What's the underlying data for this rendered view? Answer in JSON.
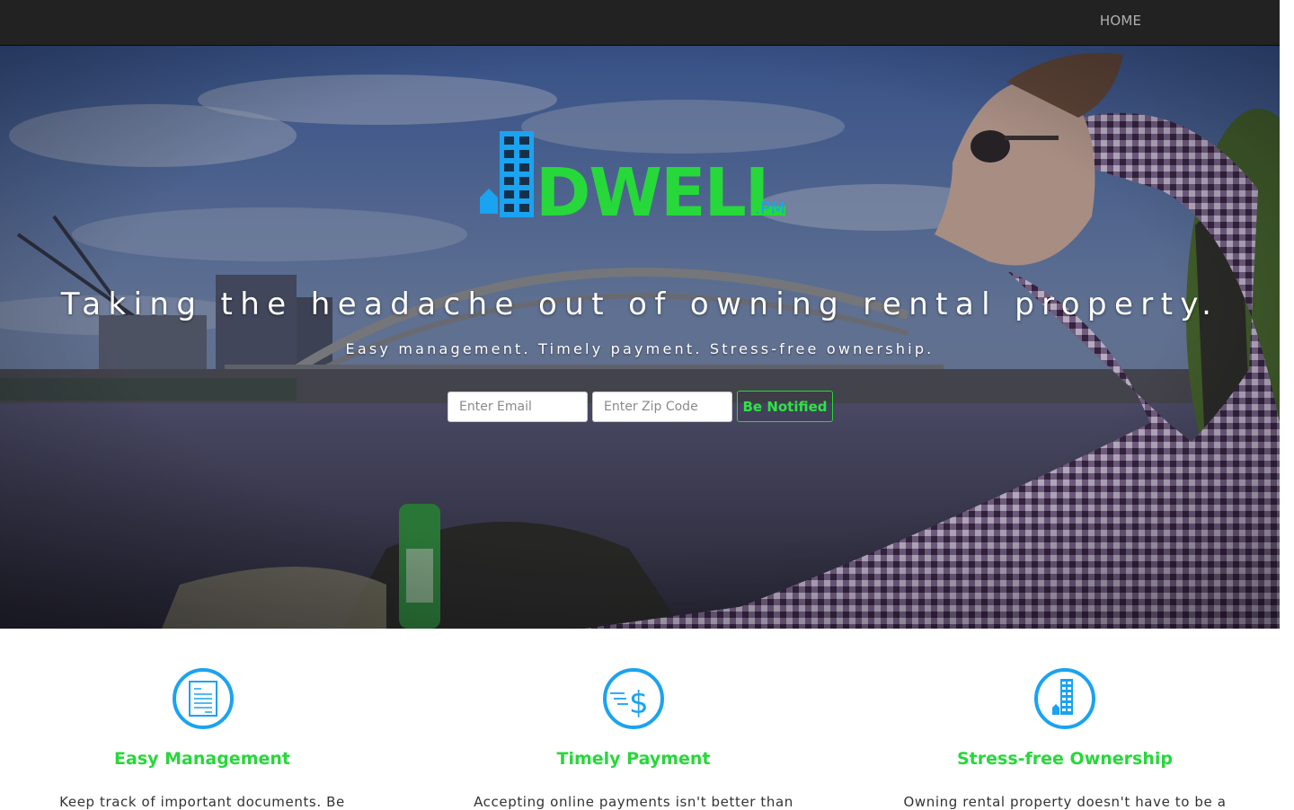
{
  "nav": {
    "home_label": "HOME"
  },
  "hero": {
    "headline": "Taking the headache out of owning rental property.",
    "subline": "Easy management. Timely payment. Stress-free ownership.",
    "logo": {
      "wordmark": "DWELL",
      "suffix": ".PM"
    },
    "form": {
      "email_placeholder": "Enter Email",
      "zip_placeholder": "Enter Zip Code",
      "submit_label": "Be Notified"
    }
  },
  "features": [
    {
      "icon": "document-icon",
      "title": "Easy Management",
      "text": "Keep track of important documents. Be"
    },
    {
      "icon": "dollar-icon",
      "title": "Timely Payment",
      "text": "Accepting online payments isn't better than"
    },
    {
      "icon": "building-icon",
      "title": "Stress-free Ownership",
      "text": "Owning rental property doesn't have to be a"
    }
  ],
  "colors": {
    "brand_green": "#27d83a",
    "brand_blue": "#1aa3f0",
    "navbar": "#222222"
  }
}
